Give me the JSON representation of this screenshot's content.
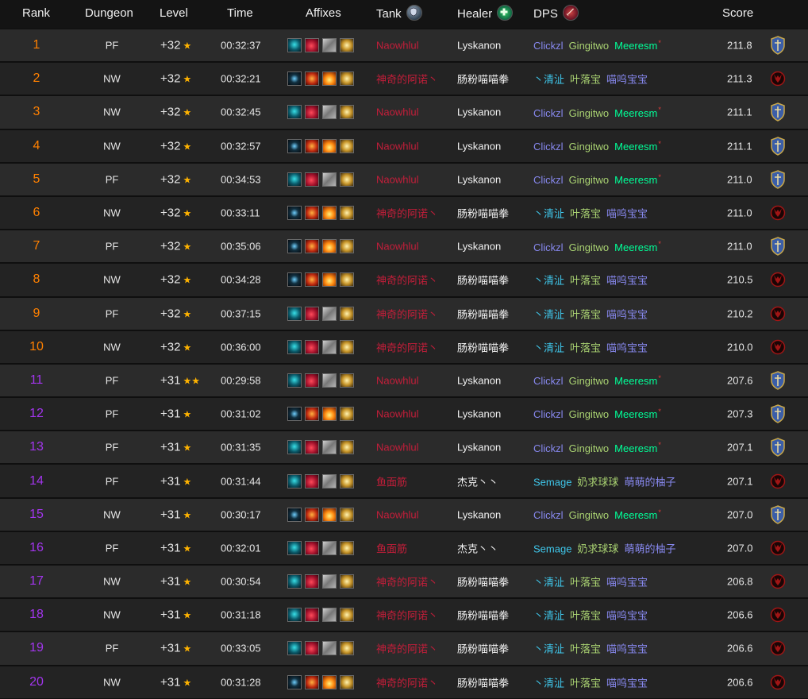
{
  "headers": {
    "rank": "Rank",
    "dungeon": "Dungeon",
    "level": "Level",
    "time": "Time",
    "affixes": "Affixes",
    "tank": "Tank",
    "healer": "Healer",
    "dps": "DPS",
    "score": "Score",
    "tank_icon": "shield-icon",
    "healer_icon": "plus-icon",
    "dps_icon": "sword-icon"
  },
  "colors": {
    "rank_top": "#ff8000",
    "rank_low": "#a335ee",
    "star": "#ffb300",
    "dk": "#c41e3a",
    "druid": "#ff7c0a",
    "monk": "#00ff98",
    "mage": "#3fc7eb",
    "hunter": "#aad372",
    "priest": "#ffffff",
    "warlock": "#8788ee",
    "alliance": "#3b5ea8",
    "horde": "#a01515"
  },
  "affix_sets": {
    "A": [
      "affix-icon-teal",
      "affix-icon-crimson",
      "affix-icon-grey",
      "affix-icon-gold"
    ],
    "B": [
      "affix-icon-dark",
      "affix-icon-red",
      "affix-icon-orange",
      "affix-icon-gold"
    ]
  },
  "rows": [
    {
      "rank": "1",
      "dungeon": "PF",
      "level": "+32",
      "stars": "★",
      "time": "00:32:37",
      "affix": "A",
      "tank": {
        "name": "Naowhlul",
        "color": "#c41e3a"
      },
      "healer": "Lyskanon",
      "dps": [
        {
          "name": "Clickzl",
          "color": "#8788ee"
        },
        {
          "name": "Gingitwo",
          "color": "#aad372"
        },
        {
          "name": "Meeresm",
          "color": "#00ff98",
          "mark": "*"
        }
      ],
      "score": "211.8",
      "faction": "alliance"
    },
    {
      "rank": "2",
      "dungeon": "NW",
      "level": "+32",
      "stars": "★",
      "time": "00:32:21",
      "affix": "B",
      "tank": {
        "name": "神奇的阿诺丶",
        "color": "#c41e3a"
      },
      "healer": "肠粉喵喵拳",
      "dps": [
        {
          "name": "丶清沚",
          "color": "#3fc7eb"
        },
        {
          "name": "叶落宝",
          "color": "#aad372"
        },
        {
          "name": "喵呜宝宝",
          "color": "#8788ee"
        }
      ],
      "score": "211.3",
      "faction": "horde"
    },
    {
      "rank": "3",
      "dungeon": "NW",
      "level": "+32",
      "stars": "★",
      "time": "00:32:45",
      "affix": "A",
      "tank": {
        "name": "Naowhlul",
        "color": "#c41e3a"
      },
      "healer": "Lyskanon",
      "dps": [
        {
          "name": "Clickzl",
          "color": "#8788ee"
        },
        {
          "name": "Gingitwo",
          "color": "#aad372"
        },
        {
          "name": "Meeresm",
          "color": "#00ff98",
          "mark": "*"
        }
      ],
      "score": "211.1",
      "faction": "alliance"
    },
    {
      "rank": "4",
      "dungeon": "NW",
      "level": "+32",
      "stars": "★",
      "time": "00:32:57",
      "affix": "B",
      "tank": {
        "name": "Naowhlul",
        "color": "#c41e3a"
      },
      "healer": "Lyskanon",
      "dps": [
        {
          "name": "Clickzl",
          "color": "#8788ee"
        },
        {
          "name": "Gingitwo",
          "color": "#aad372"
        },
        {
          "name": "Meeresm",
          "color": "#00ff98",
          "mark": "*"
        }
      ],
      "score": "211.1",
      "faction": "alliance"
    },
    {
      "rank": "5",
      "dungeon": "PF",
      "level": "+32",
      "stars": "★",
      "time": "00:34:53",
      "affix": "A",
      "tank": {
        "name": "Naowhlul",
        "color": "#c41e3a"
      },
      "healer": "Lyskanon",
      "dps": [
        {
          "name": "Clickzl",
          "color": "#8788ee"
        },
        {
          "name": "Gingitwo",
          "color": "#aad372"
        },
        {
          "name": "Meeresm",
          "color": "#00ff98",
          "mark": "*"
        }
      ],
      "score": "211.0",
      "faction": "alliance"
    },
    {
      "rank": "6",
      "dungeon": "NW",
      "level": "+32",
      "stars": "★",
      "time": "00:33:11",
      "affix": "B",
      "tank": {
        "name": "神奇的阿诺丶",
        "color": "#c41e3a"
      },
      "healer": "肠粉喵喵拳",
      "dps": [
        {
          "name": "丶清沚",
          "color": "#3fc7eb"
        },
        {
          "name": "叶落宝",
          "color": "#aad372"
        },
        {
          "name": "喵呜宝宝",
          "color": "#8788ee"
        }
      ],
      "score": "211.0",
      "faction": "horde"
    },
    {
      "rank": "7",
      "dungeon": "PF",
      "level": "+32",
      "stars": "★",
      "time": "00:35:06",
      "affix": "B",
      "tank": {
        "name": "Naowhlul",
        "color": "#c41e3a"
      },
      "healer": "Lyskanon",
      "dps": [
        {
          "name": "Clickzl",
          "color": "#8788ee"
        },
        {
          "name": "Gingitwo",
          "color": "#aad372"
        },
        {
          "name": "Meeresm",
          "color": "#00ff98",
          "mark": "*"
        }
      ],
      "score": "211.0",
      "faction": "alliance"
    },
    {
      "rank": "8",
      "dungeon": "NW",
      "level": "+32",
      "stars": "★",
      "time": "00:34:28",
      "affix": "B",
      "tank": {
        "name": "神奇的阿诺丶",
        "color": "#c41e3a"
      },
      "healer": "肠粉喵喵拳",
      "dps": [
        {
          "name": "丶清沚",
          "color": "#3fc7eb"
        },
        {
          "name": "叶落宝",
          "color": "#aad372"
        },
        {
          "name": "喵呜宝宝",
          "color": "#8788ee"
        }
      ],
      "score": "210.5",
      "faction": "horde"
    },
    {
      "rank": "9",
      "dungeon": "PF",
      "level": "+32",
      "stars": "★",
      "time": "00:37:15",
      "affix": "A",
      "tank": {
        "name": "神奇的阿诺丶",
        "color": "#c41e3a"
      },
      "healer": "肠粉喵喵拳",
      "dps": [
        {
          "name": "丶清沚",
          "color": "#3fc7eb"
        },
        {
          "name": "叶落宝",
          "color": "#aad372"
        },
        {
          "name": "喵呜宝宝",
          "color": "#8788ee"
        }
      ],
      "score": "210.2",
      "faction": "horde"
    },
    {
      "rank": "10",
      "dungeon": "NW",
      "level": "+32",
      "stars": "★",
      "time": "00:36:00",
      "affix": "A",
      "tank": {
        "name": "神奇的阿诺丶",
        "color": "#c41e3a"
      },
      "healer": "肠粉喵喵拳",
      "dps": [
        {
          "name": "丶清沚",
          "color": "#3fc7eb"
        },
        {
          "name": "叶落宝",
          "color": "#aad372"
        },
        {
          "name": "喵呜宝宝",
          "color": "#8788ee"
        }
      ],
      "score": "210.0",
      "faction": "horde"
    },
    {
      "rank": "11",
      "dungeon": "PF",
      "level": "+31",
      "stars": "★★",
      "time": "00:29:58",
      "affix": "A",
      "tank": {
        "name": "Naowhlul",
        "color": "#c41e3a"
      },
      "healer": "Lyskanon",
      "dps": [
        {
          "name": "Clickzl",
          "color": "#8788ee"
        },
        {
          "name": "Gingitwo",
          "color": "#aad372"
        },
        {
          "name": "Meeresm",
          "color": "#00ff98",
          "mark": "*"
        }
      ],
      "score": "207.6",
      "faction": "alliance"
    },
    {
      "rank": "12",
      "dungeon": "PF",
      "level": "+31",
      "stars": "★",
      "time": "00:31:02",
      "affix": "B",
      "tank": {
        "name": "Naowhlul",
        "color": "#c41e3a"
      },
      "healer": "Lyskanon",
      "dps": [
        {
          "name": "Clickzl",
          "color": "#8788ee"
        },
        {
          "name": "Gingitwo",
          "color": "#aad372"
        },
        {
          "name": "Meeresm",
          "color": "#00ff98",
          "mark": "*"
        }
      ],
      "score": "207.3",
      "faction": "alliance"
    },
    {
      "rank": "13",
      "dungeon": "PF",
      "level": "+31",
      "stars": "★",
      "time": "00:31:35",
      "affix": "A",
      "tank": {
        "name": "Naowhlul",
        "color": "#c41e3a"
      },
      "healer": "Lyskanon",
      "dps": [
        {
          "name": "Clickzl",
          "color": "#8788ee"
        },
        {
          "name": "Gingitwo",
          "color": "#aad372"
        },
        {
          "name": "Meeresm",
          "color": "#00ff98",
          "mark": "*"
        }
      ],
      "score": "207.1",
      "faction": "alliance"
    },
    {
      "rank": "14",
      "dungeon": "PF",
      "level": "+31",
      "stars": "★",
      "time": "00:31:44",
      "affix": "A",
      "tank": {
        "name": "鱼面筋",
        "color": "#c41e3a"
      },
      "healer": "杰克丶丶",
      "dps": [
        {
          "name": "Semage",
          "color": "#3fc7eb"
        },
        {
          "name": "奶求球球",
          "color": "#aad372"
        },
        {
          "name": "萌萌的柚子",
          "color": "#8788ee"
        }
      ],
      "score": "207.1",
      "faction": "horde"
    },
    {
      "rank": "15",
      "dungeon": "NW",
      "level": "+31",
      "stars": "★",
      "time": "00:30:17",
      "affix": "B",
      "tank": {
        "name": "Naowhlul",
        "color": "#c41e3a"
      },
      "healer": "Lyskanon",
      "dps": [
        {
          "name": "Clickzl",
          "color": "#8788ee"
        },
        {
          "name": "Gingitwo",
          "color": "#aad372"
        },
        {
          "name": "Meeresm",
          "color": "#00ff98",
          "mark": "*"
        }
      ],
      "score": "207.0",
      "faction": "alliance"
    },
    {
      "rank": "16",
      "dungeon": "PF",
      "level": "+31",
      "stars": "★",
      "time": "00:32:01",
      "affix": "A",
      "tank": {
        "name": "鱼面筋",
        "color": "#c41e3a"
      },
      "healer": "杰克丶丶",
      "dps": [
        {
          "name": "Semage",
          "color": "#3fc7eb"
        },
        {
          "name": "奶求球球",
          "color": "#aad372"
        },
        {
          "name": "萌萌的柚子",
          "color": "#8788ee"
        }
      ],
      "score": "207.0",
      "faction": "horde"
    },
    {
      "rank": "17",
      "dungeon": "NW",
      "level": "+31",
      "stars": "★",
      "time": "00:30:54",
      "affix": "A",
      "tank": {
        "name": "神奇的阿诺丶",
        "color": "#c41e3a"
      },
      "healer": "肠粉喵喵拳",
      "dps": [
        {
          "name": "丶清沚",
          "color": "#3fc7eb"
        },
        {
          "name": "叶落宝",
          "color": "#aad372"
        },
        {
          "name": "喵呜宝宝",
          "color": "#8788ee"
        }
      ],
      "score": "206.8",
      "faction": "horde"
    },
    {
      "rank": "18",
      "dungeon": "NW",
      "level": "+31",
      "stars": "★",
      "time": "00:31:18",
      "affix": "A",
      "tank": {
        "name": "神奇的阿诺丶",
        "color": "#c41e3a"
      },
      "healer": "肠粉喵喵拳",
      "dps": [
        {
          "name": "丶清沚",
          "color": "#3fc7eb"
        },
        {
          "name": "叶落宝",
          "color": "#aad372"
        },
        {
          "name": "喵呜宝宝",
          "color": "#8788ee"
        }
      ],
      "score": "206.6",
      "faction": "horde"
    },
    {
      "rank": "19",
      "dungeon": "PF",
      "level": "+31",
      "stars": "★",
      "time": "00:33:05",
      "affix": "A",
      "tank": {
        "name": "神奇的阿诺丶",
        "color": "#c41e3a"
      },
      "healer": "肠粉喵喵拳",
      "dps": [
        {
          "name": "丶清沚",
          "color": "#3fc7eb"
        },
        {
          "name": "叶落宝",
          "color": "#aad372"
        },
        {
          "name": "喵呜宝宝",
          "color": "#8788ee"
        }
      ],
      "score": "206.6",
      "faction": "horde"
    },
    {
      "rank": "20",
      "dungeon": "NW",
      "level": "+31",
      "stars": "★",
      "time": "00:31:28",
      "affix": "B",
      "tank": {
        "name": "神奇的阿诺丶",
        "color": "#c41e3a"
      },
      "healer": "肠粉喵喵拳",
      "dps": [
        {
          "name": "丶清沚",
          "color": "#3fc7eb"
        },
        {
          "name": "叶落宝",
          "color": "#aad372"
        },
        {
          "name": "喵呜宝宝",
          "color": "#8788ee"
        }
      ],
      "score": "206.6",
      "faction": "horde"
    }
  ]
}
